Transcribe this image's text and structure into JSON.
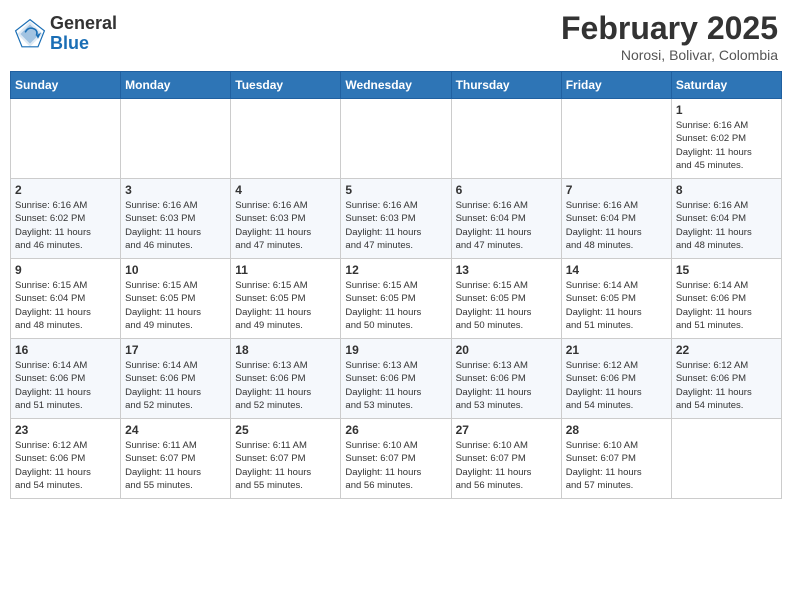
{
  "logo": {
    "general": "General",
    "blue": "Blue"
  },
  "header": {
    "month": "February 2025",
    "location": "Norosi, Bolivar, Colombia"
  },
  "weekdays": [
    "Sunday",
    "Monday",
    "Tuesday",
    "Wednesday",
    "Thursday",
    "Friday",
    "Saturday"
  ],
  "weeks": [
    [
      {
        "day": "",
        "info": ""
      },
      {
        "day": "",
        "info": ""
      },
      {
        "day": "",
        "info": ""
      },
      {
        "day": "",
        "info": ""
      },
      {
        "day": "",
        "info": ""
      },
      {
        "day": "",
        "info": ""
      },
      {
        "day": "1",
        "info": "Sunrise: 6:16 AM\nSunset: 6:02 PM\nDaylight: 11 hours\nand 45 minutes."
      }
    ],
    [
      {
        "day": "2",
        "info": "Sunrise: 6:16 AM\nSunset: 6:02 PM\nDaylight: 11 hours\nand 46 minutes."
      },
      {
        "day": "3",
        "info": "Sunrise: 6:16 AM\nSunset: 6:03 PM\nDaylight: 11 hours\nand 46 minutes."
      },
      {
        "day": "4",
        "info": "Sunrise: 6:16 AM\nSunset: 6:03 PM\nDaylight: 11 hours\nand 47 minutes."
      },
      {
        "day": "5",
        "info": "Sunrise: 6:16 AM\nSunset: 6:03 PM\nDaylight: 11 hours\nand 47 minutes."
      },
      {
        "day": "6",
        "info": "Sunrise: 6:16 AM\nSunset: 6:04 PM\nDaylight: 11 hours\nand 47 minutes."
      },
      {
        "day": "7",
        "info": "Sunrise: 6:16 AM\nSunset: 6:04 PM\nDaylight: 11 hours\nand 48 minutes."
      },
      {
        "day": "8",
        "info": "Sunrise: 6:16 AM\nSunset: 6:04 PM\nDaylight: 11 hours\nand 48 minutes."
      }
    ],
    [
      {
        "day": "9",
        "info": "Sunrise: 6:15 AM\nSunset: 6:04 PM\nDaylight: 11 hours\nand 48 minutes."
      },
      {
        "day": "10",
        "info": "Sunrise: 6:15 AM\nSunset: 6:05 PM\nDaylight: 11 hours\nand 49 minutes."
      },
      {
        "day": "11",
        "info": "Sunrise: 6:15 AM\nSunset: 6:05 PM\nDaylight: 11 hours\nand 49 minutes."
      },
      {
        "day": "12",
        "info": "Sunrise: 6:15 AM\nSunset: 6:05 PM\nDaylight: 11 hours\nand 50 minutes."
      },
      {
        "day": "13",
        "info": "Sunrise: 6:15 AM\nSunset: 6:05 PM\nDaylight: 11 hours\nand 50 minutes."
      },
      {
        "day": "14",
        "info": "Sunrise: 6:14 AM\nSunset: 6:05 PM\nDaylight: 11 hours\nand 51 minutes."
      },
      {
        "day": "15",
        "info": "Sunrise: 6:14 AM\nSunset: 6:06 PM\nDaylight: 11 hours\nand 51 minutes."
      }
    ],
    [
      {
        "day": "16",
        "info": "Sunrise: 6:14 AM\nSunset: 6:06 PM\nDaylight: 11 hours\nand 51 minutes."
      },
      {
        "day": "17",
        "info": "Sunrise: 6:14 AM\nSunset: 6:06 PM\nDaylight: 11 hours\nand 52 minutes."
      },
      {
        "day": "18",
        "info": "Sunrise: 6:13 AM\nSunset: 6:06 PM\nDaylight: 11 hours\nand 52 minutes."
      },
      {
        "day": "19",
        "info": "Sunrise: 6:13 AM\nSunset: 6:06 PM\nDaylight: 11 hours\nand 53 minutes."
      },
      {
        "day": "20",
        "info": "Sunrise: 6:13 AM\nSunset: 6:06 PM\nDaylight: 11 hours\nand 53 minutes."
      },
      {
        "day": "21",
        "info": "Sunrise: 6:12 AM\nSunset: 6:06 PM\nDaylight: 11 hours\nand 54 minutes."
      },
      {
        "day": "22",
        "info": "Sunrise: 6:12 AM\nSunset: 6:06 PM\nDaylight: 11 hours\nand 54 minutes."
      }
    ],
    [
      {
        "day": "23",
        "info": "Sunrise: 6:12 AM\nSunset: 6:06 PM\nDaylight: 11 hours\nand 54 minutes."
      },
      {
        "day": "24",
        "info": "Sunrise: 6:11 AM\nSunset: 6:07 PM\nDaylight: 11 hours\nand 55 minutes."
      },
      {
        "day": "25",
        "info": "Sunrise: 6:11 AM\nSunset: 6:07 PM\nDaylight: 11 hours\nand 55 minutes."
      },
      {
        "day": "26",
        "info": "Sunrise: 6:10 AM\nSunset: 6:07 PM\nDaylight: 11 hours\nand 56 minutes."
      },
      {
        "day": "27",
        "info": "Sunrise: 6:10 AM\nSunset: 6:07 PM\nDaylight: 11 hours\nand 56 minutes."
      },
      {
        "day": "28",
        "info": "Sunrise: 6:10 AM\nSunset: 6:07 PM\nDaylight: 11 hours\nand 57 minutes."
      },
      {
        "day": "",
        "info": ""
      }
    ]
  ]
}
